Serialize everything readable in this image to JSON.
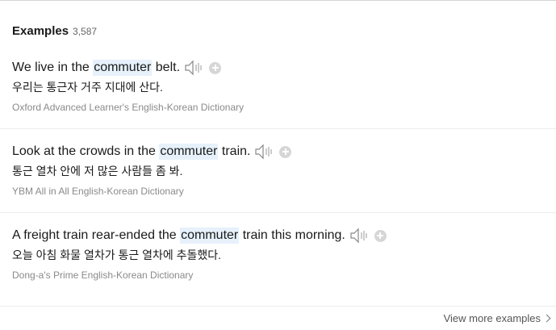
{
  "header": {
    "title": "Examples",
    "count": "3,587"
  },
  "examples": [
    {
      "before": "We live in the ",
      "highlight": "commuter",
      "after": " belt.",
      "translation": "우리는 통근자 거주 지대에 산다.",
      "source": "Oxford Advanced Learner's English-Korean Dictionary"
    },
    {
      "before": "Look at the crowds in the ",
      "highlight": "commuter",
      "after": " train.",
      "translation": "통근 열차 안에 저 많은 사람들 좀 봐.",
      "source": "YBM All in All English-Korean Dictionary"
    },
    {
      "before": "A freight train rear-ended the ",
      "highlight": "commuter",
      "after": " train this morning.",
      "translation": "오늘 아침 화물 열차가 통근 열차에 추돌했다.",
      "source": "Dong-a's Prime English-Korean Dictionary"
    }
  ],
  "footer": {
    "view_more": "View more examples"
  },
  "icons": {
    "speaker": "speaker-icon",
    "add": "plus-circle-icon",
    "chevron": "chevron-right-icon"
  },
  "colors": {
    "highlight": "#e6f1fb",
    "source_text": "#8a8a8a",
    "add_button": "#d6d6d6"
  }
}
